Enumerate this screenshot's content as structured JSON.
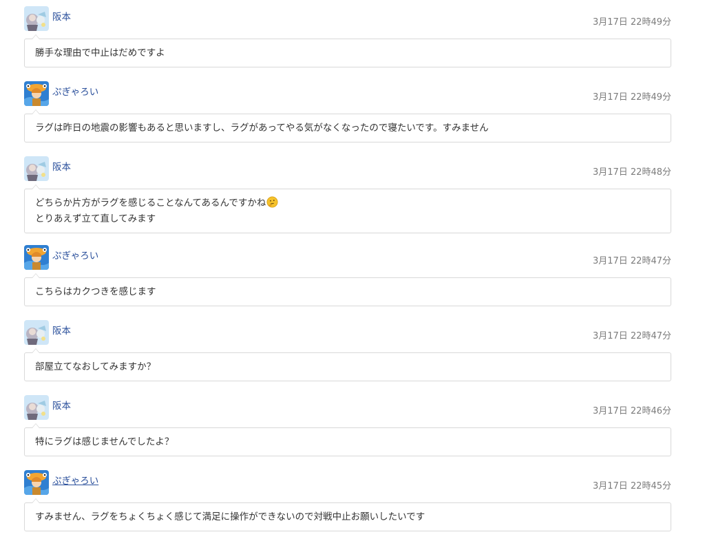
{
  "messages": [
    {
      "user": "阪本",
      "avatar": "sakamoto-avatar",
      "time": "3月17日 22時49分",
      "text": "勝手な理由で中止はだめですよ",
      "underline": false,
      "emoji": false
    },
    {
      "user": "ぷぎゃろい",
      "avatar": "pugyaroi-avatar",
      "time": "3月17日 22時49分",
      "text": "ラグは昨日の地震の影響もあると思いますし、ラグがあってやる気がなくなったので寝たいです。すみません",
      "underline": false,
      "emoji": false
    },
    {
      "user": "阪本",
      "avatar": "sakamoto-avatar",
      "time": "3月17日 22時48分",
      "text": "どちらか片方がラグを感じることなんてあるんですかね",
      "text2": "とりあえず立て直してみます",
      "underline": false,
      "emoji": true,
      "emoji_icon": "thinking-face-icon"
    },
    {
      "user": "ぷぎゃろい",
      "avatar": "pugyaroi-avatar",
      "time": "3月17日 22時47分",
      "text": "こちらはカクつきを感じます",
      "underline": false,
      "emoji": false
    },
    {
      "user": "阪本",
      "avatar": "sakamoto-avatar",
      "time": "3月17日 22時47分",
      "text": "部屋立てなおしてみますか？",
      "underline": false,
      "emoji": false
    },
    {
      "user": "阪本",
      "avatar": "sakamoto-avatar",
      "time": "3月17日 22時46分",
      "text": "特にラグは感じませんでしたよ？",
      "underline": false,
      "emoji": false
    },
    {
      "user": "ぷぎゃろい",
      "avatar": "pugyaroi-avatar",
      "time": "3月17日 22時45分",
      "text": "すみません、ラグをちょくちょく感じて満足に操作ができないので対戦中止お願いしたいです",
      "underline": true,
      "emoji": false
    }
  ],
  "colors": {
    "username": "#2a4f9b",
    "timestamp": "#7b7b7b",
    "border": "#d8d8d8",
    "text": "#333333"
  }
}
